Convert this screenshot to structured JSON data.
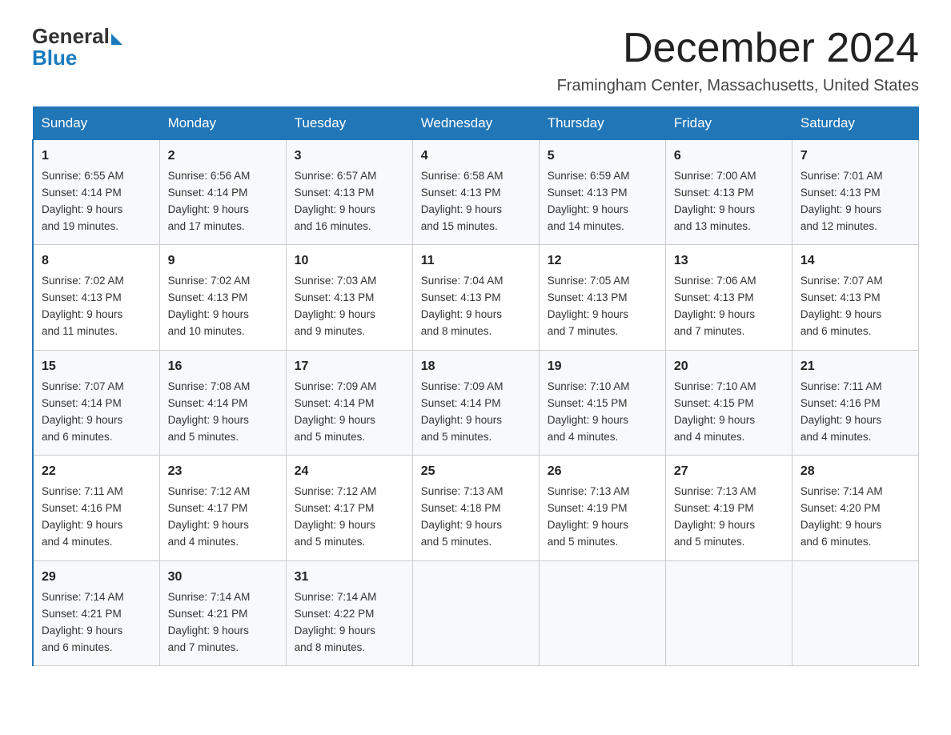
{
  "logo": {
    "text_general": "General",
    "text_blue": "Blue"
  },
  "title": "December 2024",
  "location": "Framingham Center, Massachusetts, United States",
  "days_of_week": [
    "Sunday",
    "Monday",
    "Tuesday",
    "Wednesday",
    "Thursday",
    "Friday",
    "Saturday"
  ],
  "weeks": [
    [
      {
        "day": "1",
        "info": "Sunrise: 6:55 AM\nSunset: 4:14 PM\nDaylight: 9 hours\nand 19 minutes."
      },
      {
        "day": "2",
        "info": "Sunrise: 6:56 AM\nSunset: 4:14 PM\nDaylight: 9 hours\nand 17 minutes."
      },
      {
        "day": "3",
        "info": "Sunrise: 6:57 AM\nSunset: 4:13 PM\nDaylight: 9 hours\nand 16 minutes."
      },
      {
        "day": "4",
        "info": "Sunrise: 6:58 AM\nSunset: 4:13 PM\nDaylight: 9 hours\nand 15 minutes."
      },
      {
        "day": "5",
        "info": "Sunrise: 6:59 AM\nSunset: 4:13 PM\nDaylight: 9 hours\nand 14 minutes."
      },
      {
        "day": "6",
        "info": "Sunrise: 7:00 AM\nSunset: 4:13 PM\nDaylight: 9 hours\nand 13 minutes."
      },
      {
        "day": "7",
        "info": "Sunrise: 7:01 AM\nSunset: 4:13 PM\nDaylight: 9 hours\nand 12 minutes."
      }
    ],
    [
      {
        "day": "8",
        "info": "Sunrise: 7:02 AM\nSunset: 4:13 PM\nDaylight: 9 hours\nand 11 minutes."
      },
      {
        "day": "9",
        "info": "Sunrise: 7:02 AM\nSunset: 4:13 PM\nDaylight: 9 hours\nand 10 minutes."
      },
      {
        "day": "10",
        "info": "Sunrise: 7:03 AM\nSunset: 4:13 PM\nDaylight: 9 hours\nand 9 minutes."
      },
      {
        "day": "11",
        "info": "Sunrise: 7:04 AM\nSunset: 4:13 PM\nDaylight: 9 hours\nand 8 minutes."
      },
      {
        "day": "12",
        "info": "Sunrise: 7:05 AM\nSunset: 4:13 PM\nDaylight: 9 hours\nand 7 minutes."
      },
      {
        "day": "13",
        "info": "Sunrise: 7:06 AM\nSunset: 4:13 PM\nDaylight: 9 hours\nand 7 minutes."
      },
      {
        "day": "14",
        "info": "Sunrise: 7:07 AM\nSunset: 4:13 PM\nDaylight: 9 hours\nand 6 minutes."
      }
    ],
    [
      {
        "day": "15",
        "info": "Sunrise: 7:07 AM\nSunset: 4:14 PM\nDaylight: 9 hours\nand 6 minutes."
      },
      {
        "day": "16",
        "info": "Sunrise: 7:08 AM\nSunset: 4:14 PM\nDaylight: 9 hours\nand 5 minutes."
      },
      {
        "day": "17",
        "info": "Sunrise: 7:09 AM\nSunset: 4:14 PM\nDaylight: 9 hours\nand 5 minutes."
      },
      {
        "day": "18",
        "info": "Sunrise: 7:09 AM\nSunset: 4:14 PM\nDaylight: 9 hours\nand 5 minutes."
      },
      {
        "day": "19",
        "info": "Sunrise: 7:10 AM\nSunset: 4:15 PM\nDaylight: 9 hours\nand 4 minutes."
      },
      {
        "day": "20",
        "info": "Sunrise: 7:10 AM\nSunset: 4:15 PM\nDaylight: 9 hours\nand 4 minutes."
      },
      {
        "day": "21",
        "info": "Sunrise: 7:11 AM\nSunset: 4:16 PM\nDaylight: 9 hours\nand 4 minutes."
      }
    ],
    [
      {
        "day": "22",
        "info": "Sunrise: 7:11 AM\nSunset: 4:16 PM\nDaylight: 9 hours\nand 4 minutes."
      },
      {
        "day": "23",
        "info": "Sunrise: 7:12 AM\nSunset: 4:17 PM\nDaylight: 9 hours\nand 4 minutes."
      },
      {
        "day": "24",
        "info": "Sunrise: 7:12 AM\nSunset: 4:17 PM\nDaylight: 9 hours\nand 5 minutes."
      },
      {
        "day": "25",
        "info": "Sunrise: 7:13 AM\nSunset: 4:18 PM\nDaylight: 9 hours\nand 5 minutes."
      },
      {
        "day": "26",
        "info": "Sunrise: 7:13 AM\nSunset: 4:19 PM\nDaylight: 9 hours\nand 5 minutes."
      },
      {
        "day": "27",
        "info": "Sunrise: 7:13 AM\nSunset: 4:19 PM\nDaylight: 9 hours\nand 5 minutes."
      },
      {
        "day": "28",
        "info": "Sunrise: 7:14 AM\nSunset: 4:20 PM\nDaylight: 9 hours\nand 6 minutes."
      }
    ],
    [
      {
        "day": "29",
        "info": "Sunrise: 7:14 AM\nSunset: 4:21 PM\nDaylight: 9 hours\nand 6 minutes."
      },
      {
        "day": "30",
        "info": "Sunrise: 7:14 AM\nSunset: 4:21 PM\nDaylight: 9 hours\nand 7 minutes."
      },
      {
        "day": "31",
        "info": "Sunrise: 7:14 AM\nSunset: 4:22 PM\nDaylight: 9 hours\nand 8 minutes."
      },
      {
        "day": "",
        "info": ""
      },
      {
        "day": "",
        "info": ""
      },
      {
        "day": "",
        "info": ""
      },
      {
        "day": "",
        "info": ""
      }
    ]
  ]
}
